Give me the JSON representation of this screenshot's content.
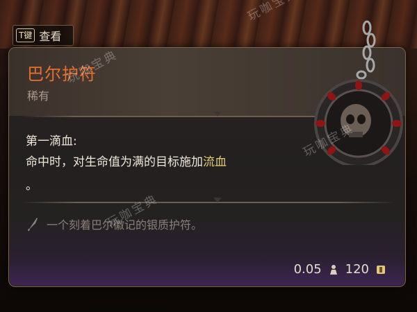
{
  "hint": {
    "key": "T键",
    "label": "查看"
  },
  "item": {
    "name": "巴尔护符",
    "rarity": "稀有",
    "passive_title": "第一滴血:",
    "passive_desc_parts": [
      "命中时，对生命值为满的目标施加",
      "流血",
      "。"
    ],
    "flavor_text": "一个刻着巴尔徽记的银质护符。",
    "weight": "0.05",
    "price": "120"
  },
  "watermarks": [
    "玩咖宝典",
    "玩咖宝典",
    "玩咖宝典",
    "玩咖宝典"
  ],
  "colors": {
    "name": "#e7702d",
    "highlight": "#e2cf7a",
    "border": "#7a6850"
  },
  "icons": {
    "flavor": "quill-icon",
    "weight": "weight-icon",
    "price": "gold-coin-icon",
    "amulet": "skull-amulet-icon"
  }
}
